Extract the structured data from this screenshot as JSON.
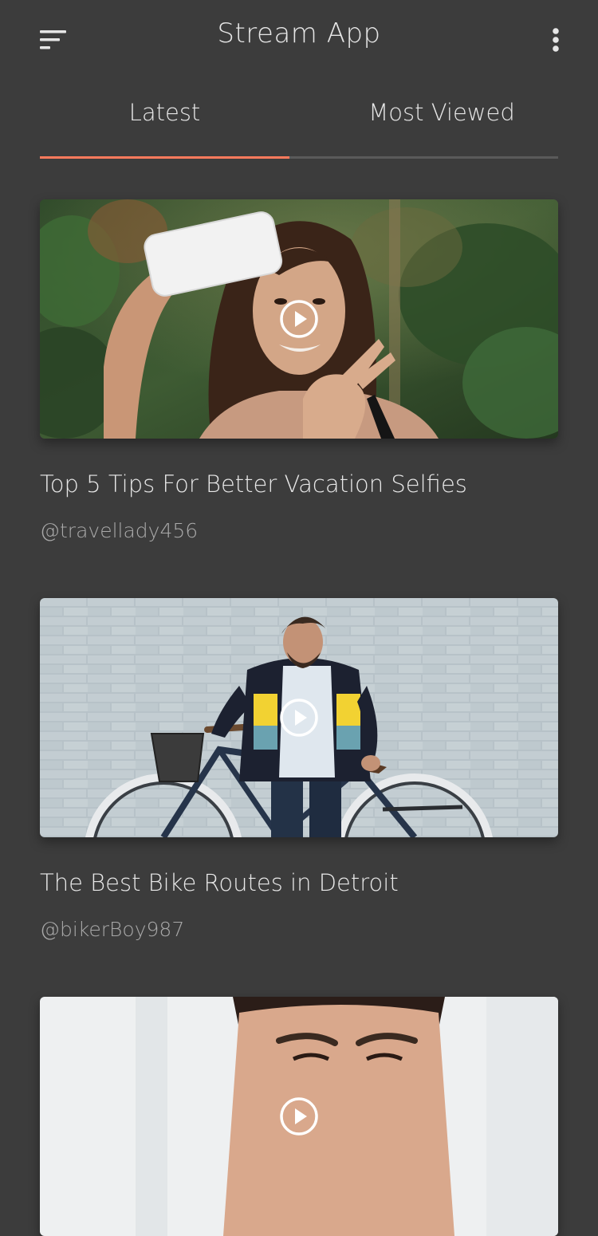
{
  "app": {
    "title": "Stream App",
    "menu_icon": "sort-menu-icon",
    "more_icon": "more-vertical-icon"
  },
  "tabs": [
    {
      "label": "Latest",
      "active": true
    },
    {
      "label": "Most Viewed",
      "active": false
    }
  ],
  "colors": {
    "background": "#3c3c3c",
    "accent": "#ff7a5c",
    "text": "#e6e6e6",
    "secondary_text": "#a9a9a9"
  },
  "feed": [
    {
      "title": "Top 5 Tips For Better Vacation Selfies",
      "author": "@travellady456",
      "thumbnail": "woman taking selfie in tropical garden",
      "play_icon": "play-circle-icon"
    },
    {
      "title": "The Best Bike Routes in Detroit",
      "author": "@bikerBoy987",
      "thumbnail": "man with bicycle against white brick wall",
      "play_icon": "play-circle-icon"
    },
    {
      "thumbnail": "close-up portrait of man",
      "play_icon": "play-circle-icon"
    }
  ]
}
